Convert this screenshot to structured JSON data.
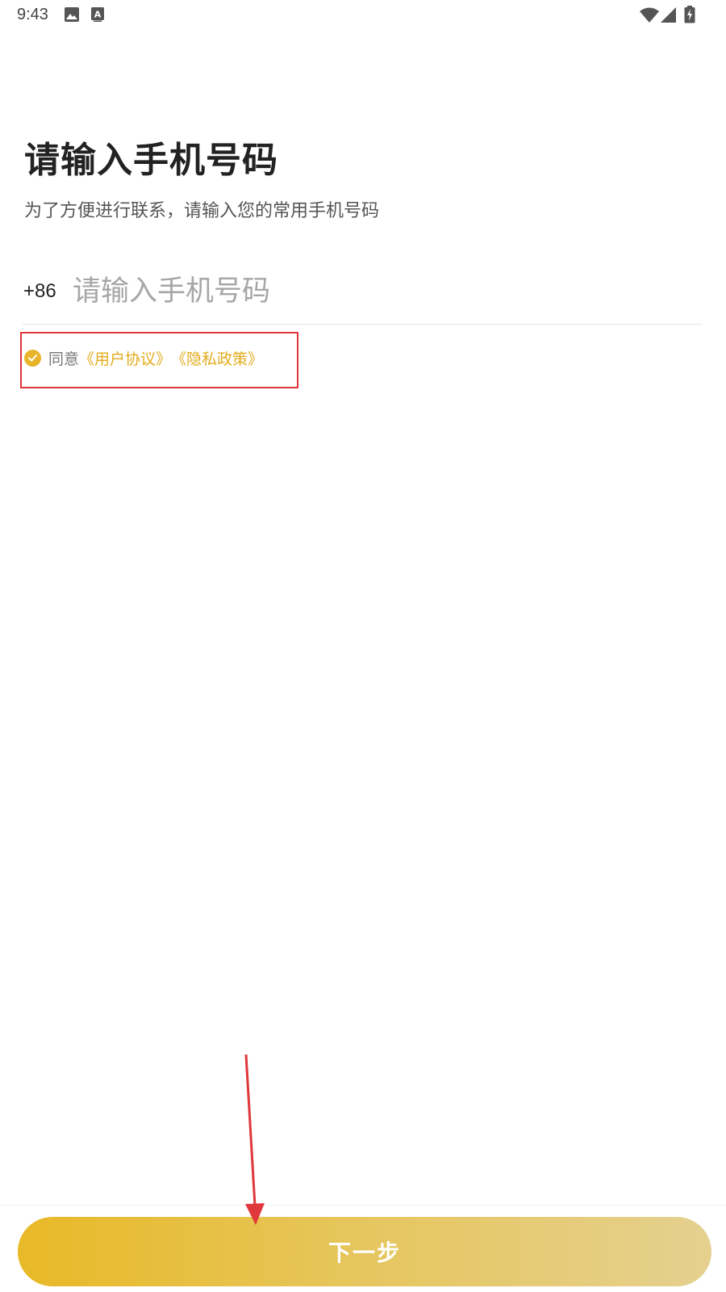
{
  "status_bar": {
    "time": "9:43",
    "icons": [
      "image-icon",
      "text-a-icon",
      "wifi-icon",
      "cell-signal-icon",
      "battery-charging-icon"
    ]
  },
  "page": {
    "title": "请输入手机号码",
    "subtitle": "为了方便进行联系，请输入您的常用手机号码"
  },
  "phone": {
    "country_code": "+86",
    "value": "",
    "placeholder": "请输入手机号码"
  },
  "agreement": {
    "checked": true,
    "prefix": "同意",
    "user_agreement": "《用户协议》",
    "privacy_policy": "《隐私政策》"
  },
  "footer": {
    "next_label": "下一步"
  },
  "colors": {
    "accent": "#e8b52a",
    "link": "#e3ac1c",
    "annotation": "#e0373a",
    "button_gradient": [
      "#e8b927",
      "#e5d08f"
    ]
  }
}
